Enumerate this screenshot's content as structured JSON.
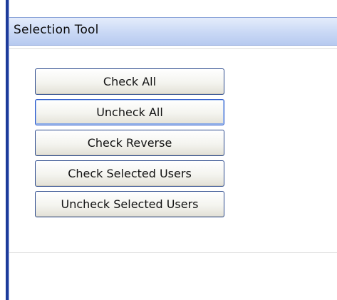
{
  "panel": {
    "title": "Selection Tool"
  },
  "buttons": {
    "check_all": "Check All",
    "uncheck_all": "Uncheck All",
    "check_reverse": "Check Reverse",
    "check_selected_users": "Check Selected Users",
    "uncheck_selected_users": "Uncheck Selected Users"
  },
  "colors": {
    "window_border": "#1d3b9a",
    "header_background": "#c9d8f5",
    "button_border": "#2c4a8c",
    "focused_button_border": "#2a57c9"
  }
}
